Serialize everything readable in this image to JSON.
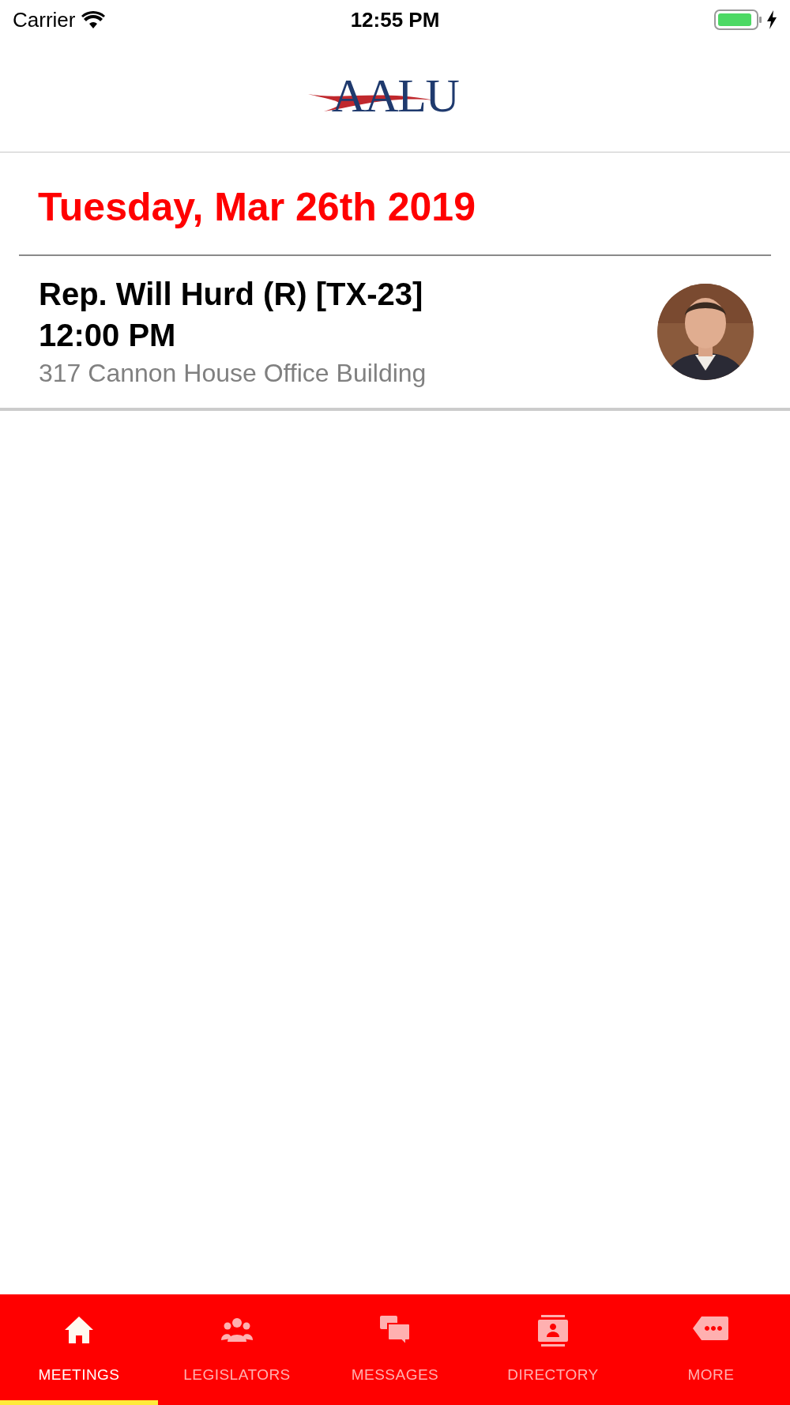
{
  "status_bar": {
    "carrier": "Carrier",
    "time": "12:55 PM"
  },
  "header": {
    "logo": "AALU"
  },
  "date_title": "Tuesday, Mar 26th 2019",
  "meetings": [
    {
      "name": "Rep. Will Hurd (R) [TX-23]",
      "time": "12:00 PM",
      "location": "317 Cannon House Office Building"
    }
  ],
  "tabs": [
    {
      "label": "MEETINGS",
      "kind": "home",
      "selected": true
    },
    {
      "label": "LEGISLATORS",
      "kind": "people",
      "selected": false
    },
    {
      "label": "MESSAGES",
      "kind": "chat",
      "selected": false
    },
    {
      "label": "DIRECTORY",
      "kind": "contact",
      "selected": false
    },
    {
      "label": "MORE",
      "kind": "more",
      "selected": false
    }
  ]
}
